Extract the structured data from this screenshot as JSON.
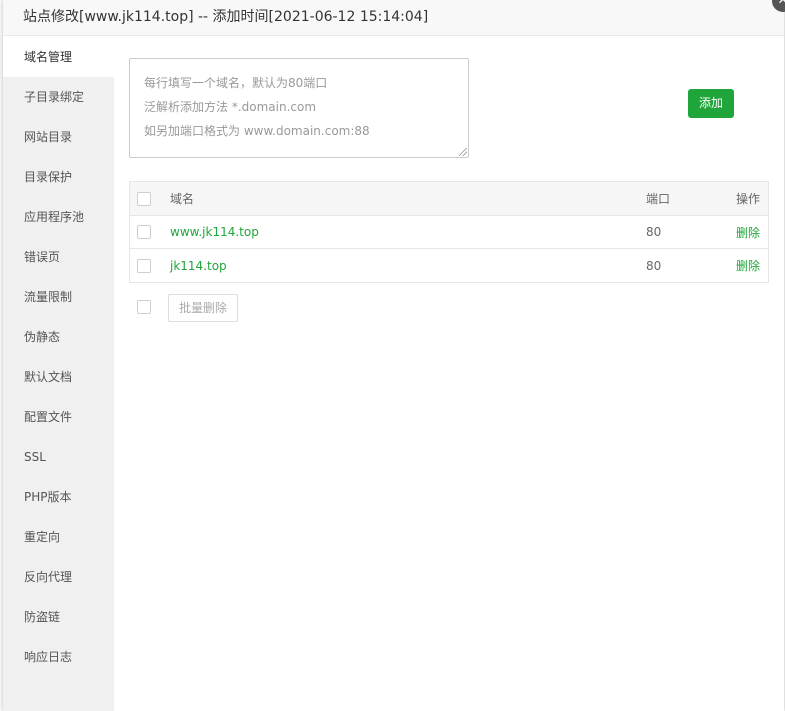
{
  "window": {
    "title": "站点修改[www.jk114.top] -- 添加时间[2021-06-12 15:14:04]",
    "close_icon": "close-icon"
  },
  "sidebar": {
    "active_index": 0,
    "items": [
      {
        "label": "域名管理"
      },
      {
        "label": "子目录绑定"
      },
      {
        "label": "网站目录"
      },
      {
        "label": "目录保护"
      },
      {
        "label": "应用程序池"
      },
      {
        "label": "错误页"
      },
      {
        "label": "流量限制"
      },
      {
        "label": "伪静态"
      },
      {
        "label": "默认文档"
      },
      {
        "label": "配置文件"
      },
      {
        "label": "SSL"
      },
      {
        "label": "PHP版本"
      },
      {
        "label": "重定向"
      },
      {
        "label": "反向代理"
      },
      {
        "label": "防盗链"
      },
      {
        "label": "响应日志"
      }
    ]
  },
  "domain_input": {
    "value": "",
    "placeholder_lines": [
      "每行填写一个域名，默认为80端口",
      "泛解析添加方法 *.domain.com",
      "如另加端口格式为 www.domain.com:88"
    ]
  },
  "add_button": {
    "label": "添加"
  },
  "table": {
    "headers": {
      "name": "域名",
      "port": "端口",
      "op": "操作"
    },
    "rows": [
      {
        "domain": "www.jk114.top",
        "port": "80",
        "action": "删除"
      },
      {
        "domain": "jk114.top",
        "port": "80",
        "action": "删除"
      }
    ]
  },
  "batch": {
    "delete_label": "批量删除"
  },
  "colors": {
    "accent": "#20a53a",
    "sidebar_bg": "#f0f0f0",
    "title_bg": "#f8f8f8"
  }
}
